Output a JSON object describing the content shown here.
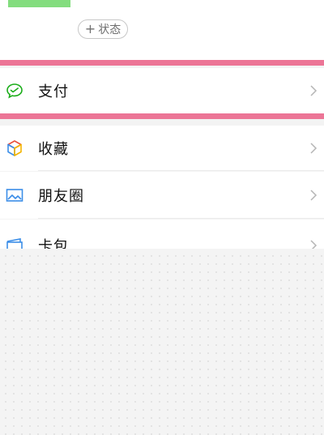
{
  "profile": {
    "status_plus": "+",
    "status_label": "状态"
  },
  "menu": [
    {
      "key": "pay",
      "label": "支付",
      "icon": "wechat-pay-icon"
    },
    {
      "key": "favorites",
      "label": "收藏",
      "icon": "cube-icon"
    },
    {
      "key": "moments",
      "label": "朋友圈",
      "icon": "image-icon"
    },
    {
      "key": "cards",
      "label": "卡包",
      "icon": "card-icon"
    }
  ],
  "colors": {
    "highlight": "#ec7596",
    "accent_green": "#83dd7e",
    "pay_icon": "#1aad19"
  }
}
